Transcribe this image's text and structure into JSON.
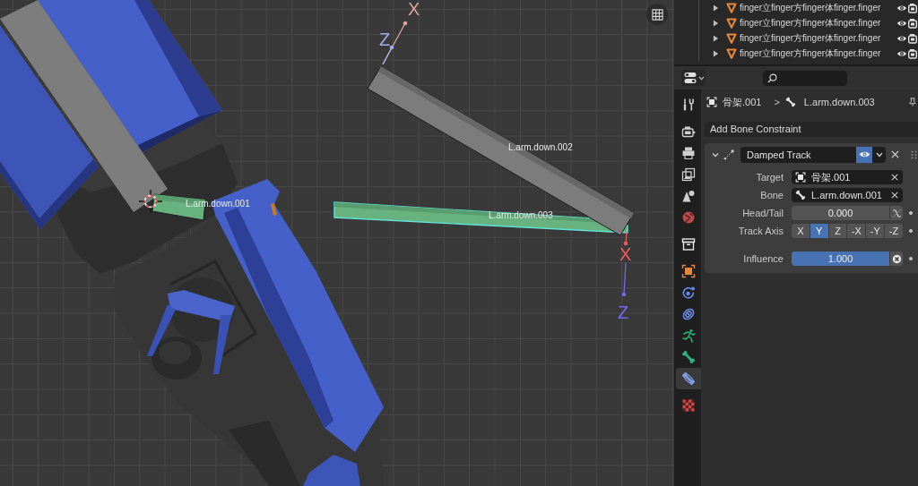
{
  "viewport": {
    "bones": [
      {
        "label": "L.arm.down.002",
        "constrained": false,
        "selected": false,
        "axis_labels": [
          "X",
          "Z"
        ]
      },
      {
        "label": "L.arm.down.003",
        "constrained": true,
        "selected": true,
        "axis_labels": [
          "X",
          "Z"
        ]
      },
      {
        "label": "L.arm.down.001",
        "constrained": true,
        "selected": false
      }
    ]
  },
  "outliner": {
    "rows": [
      {
        "name": "finger立finger方finger体finger.finger",
        "expanded": false,
        "visible": true
      },
      {
        "name": "finger立finger方finger体finger.finger",
        "expanded": false,
        "visible": true
      },
      {
        "name": "finger立finger方finger体finger.finger",
        "expanded": false,
        "visible": true
      },
      {
        "name": "finger立finger方finger体finger.finger",
        "expanded": false,
        "visible": true
      }
    ]
  },
  "properties": {
    "tab_groups": [
      {
        "tabs": [
          {
            "kind": "tool",
            "selected": false
          }
        ]
      },
      {
        "tabs": [
          {
            "kind": "render",
            "selected": false
          },
          {
            "kind": "output",
            "selected": false
          },
          {
            "kind": "view_layer",
            "selected": false
          },
          {
            "kind": "scene",
            "selected": false
          },
          {
            "kind": "world",
            "selected": false
          }
        ]
      },
      {
        "tabs": [
          {
            "kind": "collection",
            "selected": false
          }
        ]
      },
      {
        "tabs": [
          {
            "kind": "object",
            "selected": false
          },
          {
            "kind": "physics",
            "selected": false
          },
          {
            "kind": "object_constraint",
            "selected": false
          },
          {
            "kind": "armature",
            "selected": false
          },
          {
            "kind": "bone",
            "selected": false
          },
          {
            "kind": "bone_constraint",
            "selected": true
          }
        ]
      },
      {
        "tabs": [
          {
            "kind": "texture",
            "selected": false
          }
        ]
      }
    ],
    "breadcrumb": {
      "object": "骨架.001",
      "separator": ">",
      "bone": "L.arm.down.003"
    },
    "add_menu": "Add Bone Constraint",
    "constraint": {
      "name": "Damped Track",
      "expanded": true,
      "enabled": true,
      "fields": [
        {
          "kind": "object",
          "label": "Target",
          "value": "骨架.001"
        },
        {
          "kind": "bone",
          "label": "Bone",
          "value": "L.arm.down.001"
        },
        {
          "kind": "slider",
          "label": "Head/Tail",
          "value": "0.000",
          "level": 0,
          "side_button": {
            "kind": "curve"
          },
          "decorator": true
        },
        {
          "kind": "axis",
          "label": "Track Axis",
          "options": [
            {
              "label": "X",
              "selected": false
            },
            {
              "label": "Y",
              "selected": true
            },
            {
              "label": "Z",
              "selected": false
            },
            {
              "label": "-X",
              "selected": false
            },
            {
              "label": "-Y",
              "selected": false
            },
            {
              "label": "-Z",
              "selected": false
            }
          ],
          "decorator": true
        },
        {
          "kind": "slider",
          "label": "Influence",
          "value": "1.000",
          "level": 1,
          "side_button": {
            "kind": "clear"
          },
          "decorator": true
        }
      ]
    }
  }
}
